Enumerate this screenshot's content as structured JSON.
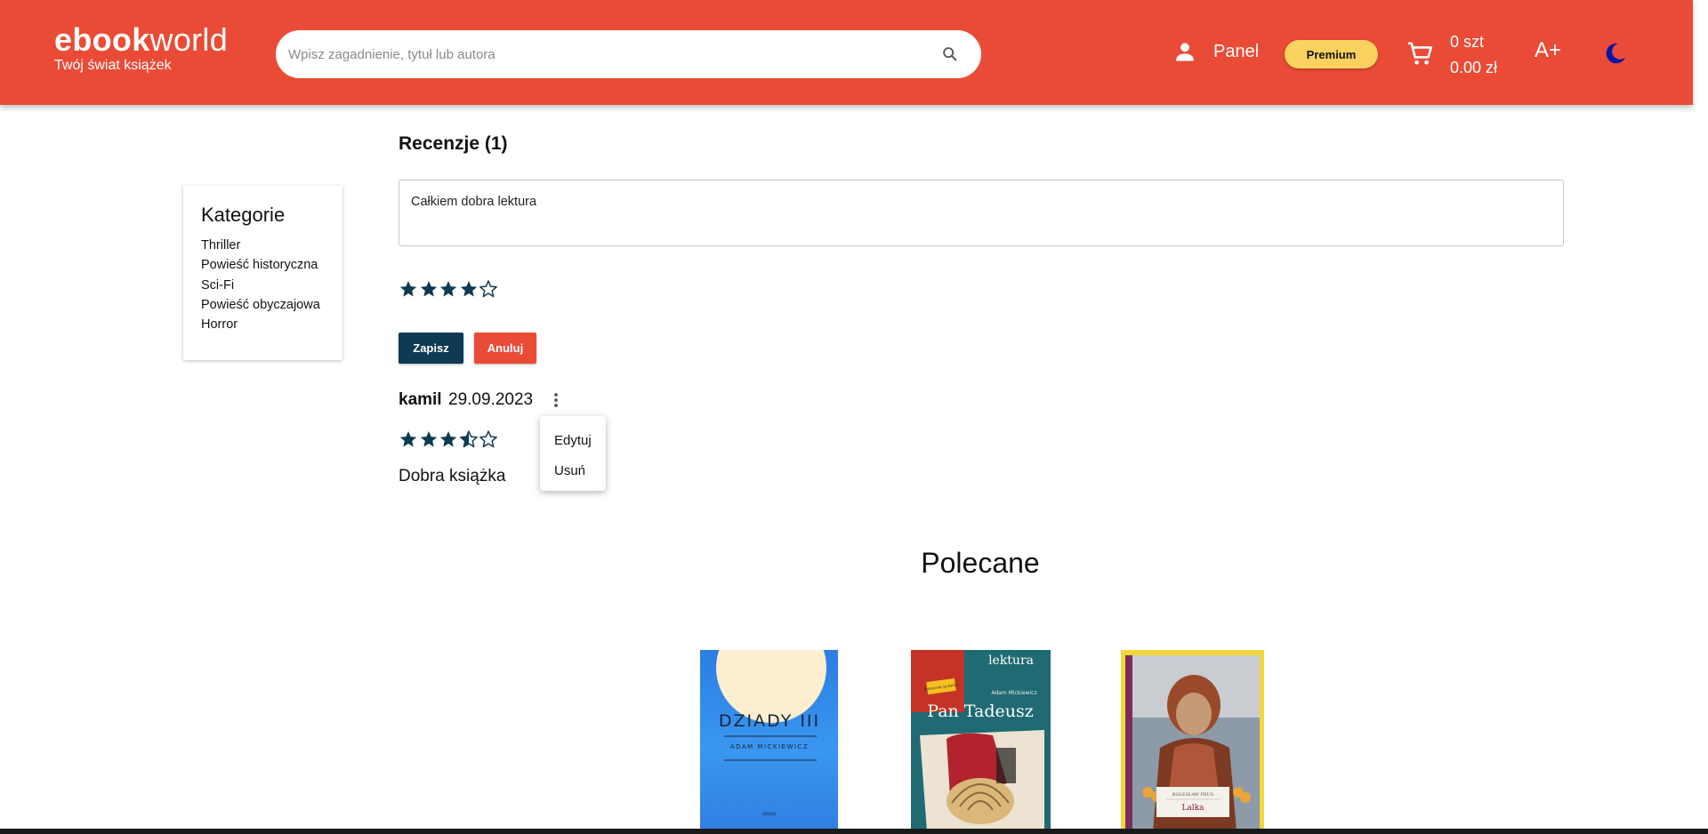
{
  "header": {
    "logo_bold": "ebook",
    "logo_light": "world",
    "tagline": "Twój świat książek",
    "search_placeholder": "Wpisz zagadnienie, tytuł lub autora",
    "panel_label": "Panel",
    "premium_label": "Premium",
    "cart_count": "0 szt",
    "cart_total": "0.00 zł",
    "font_size_label": "A+",
    "accent_color": "#ea4b36",
    "icons": [
      "search-icon",
      "user-icon",
      "cart-icon",
      "moon-icon"
    ]
  },
  "sidebar": {
    "title": "Kategorie",
    "items": [
      {
        "label": "Thriller"
      },
      {
        "label": "Powieść historyczna"
      },
      {
        "label": "Sci-Fi"
      },
      {
        "label": "Powieść obyczajowa"
      },
      {
        "label": "Horror"
      }
    ]
  },
  "reviews": {
    "title": "Recenzje (1)",
    "edit": {
      "text": "Całkiem dobra lektura",
      "rating": 4,
      "max_rating": 5,
      "save_label": "Zapisz",
      "cancel_label": "Anuluj"
    },
    "list": [
      {
        "author": "kamil",
        "date": "29.09.2023",
        "rating": 3.5,
        "text": "Dobra książka"
      }
    ],
    "menu": {
      "edit_label": "Edytuj",
      "delete_label": "Usuń"
    },
    "star_color": "#0e3a53"
  },
  "recommended": {
    "title": "Polecane",
    "books": [
      {
        "title": "DZIADY III",
        "author": "ADAM MICKIEWICZ",
        "publisher": "GREKAT"
      },
      {
        "title": "Pan Tadeusz",
        "series": "lektura",
        "author": "Adam Mickiewicz",
        "badge": "pomocnik na końcu"
      },
      {
        "title": "Lalka",
        "author": "BOLESŁAW PRUS"
      }
    ]
  }
}
